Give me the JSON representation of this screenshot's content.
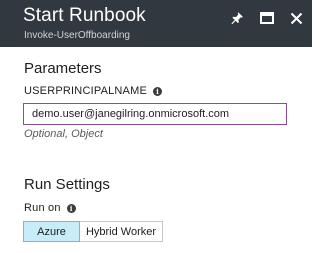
{
  "header": {
    "title": "Start Runbook",
    "subtitle": "Invoke-UserOffboarding",
    "icons": [
      "pin-icon",
      "maximize-icon",
      "close-icon"
    ]
  },
  "parameters": {
    "section_title": "Parameters",
    "field_label": "USERPRINCIPALNAME",
    "field_value": "demo.user@janegilring.onmicrosoft.com",
    "hint": "Optional, Object"
  },
  "run_settings": {
    "section_title": "Run Settings",
    "run_on_label": "Run on",
    "options": [
      "Azure",
      "Hybrid Worker"
    ],
    "selected": "Azure"
  },
  "colors": {
    "header_bg": "#32383f",
    "input_border": "#8a4d96",
    "selected_bg": "#c7ecfa"
  }
}
